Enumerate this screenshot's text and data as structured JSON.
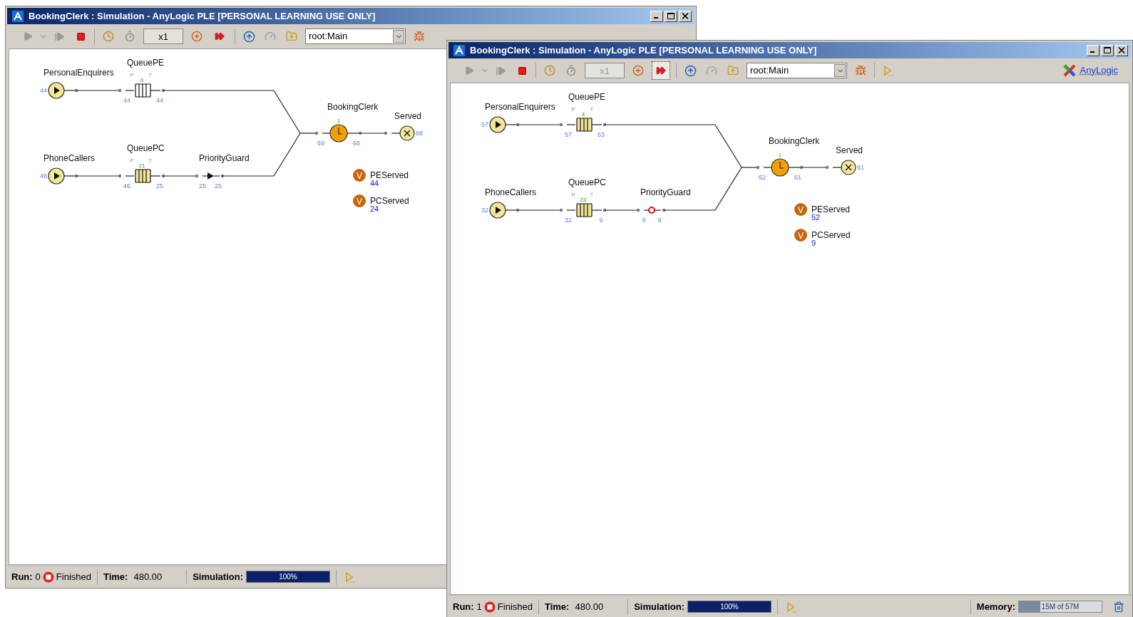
{
  "windows": [
    {
      "title": "BookingClerk : Simulation - AnyLogic PLE [PERSONAL LEARNING USE ONLY]",
      "toolbar": {
        "speed": {
          "value": "x1",
          "disabled": false
        },
        "model": "root:Main",
        "fast_forward_pressed": false
      },
      "diagram": {
        "sources": [
          {
            "name": "PersonalEnquirers",
            "count": "44"
          },
          {
            "name": "PhoneCallers",
            "count": "46"
          }
        ],
        "queues": [
          {
            "name": "QueuePE",
            "p": "P",
            "t": "T",
            "size": "0",
            "in": "44",
            "out": "44",
            "filled": false
          },
          {
            "name": "QueuePC",
            "p": "P",
            "t": "T",
            "size": "21",
            "in": "46",
            "out": "25",
            "filled": true
          }
        ],
        "hold": {
          "name": "PriorityGuard",
          "in": "25",
          "out": "25",
          "blocked": false
        },
        "service": {
          "name": "BookingClerk",
          "busy": "1",
          "in": "69",
          "out": "68"
        },
        "sink": {
          "name": "Served",
          "count": "68"
        },
        "variables": [
          {
            "icon": "V",
            "name": "PEServed",
            "value": "44"
          },
          {
            "icon": "V",
            "name": "PCServed",
            "value": "24"
          }
        ]
      },
      "status_bar": {
        "run_label": "Run:",
        "run": "0",
        "state": "Finished",
        "time_label": "Time:",
        "time": "480.00",
        "simulation_label": "Simulation:",
        "progress": {
          "level": 1,
          "text": "100%"
        }
      }
    },
    {
      "title": "BookingClerk : Simulation - AnyLogic PLE [PERSONAL LEARNING USE ONLY]",
      "toolbar": {
        "speed": {
          "value": "x1",
          "disabled": true
        },
        "model": "root:Main",
        "fast_forward_pressed": true,
        "link": "AnyLogic"
      },
      "diagram": {
        "sources": [
          {
            "name": "PersonalEnquirers",
            "count": "57"
          },
          {
            "name": "PhoneCallers",
            "count": "32"
          }
        ],
        "queues": [
          {
            "name": "QueuePE",
            "p": "P",
            "t": "T",
            "size": "4",
            "in": "57",
            "out": "53",
            "filled": true
          },
          {
            "name": "QueuePC",
            "p": "P",
            "t": "T",
            "size": "23",
            "in": "32",
            "out": "9",
            "filled": true
          }
        ],
        "hold": {
          "name": "PriorityGuard",
          "in": "9",
          "out": "9",
          "blocked": true
        },
        "service": {
          "name": "BookingClerk",
          "busy": "1",
          "in": "62",
          "out": "61"
        },
        "sink": {
          "name": "Served",
          "count": "61"
        },
        "variables": [
          {
            "icon": "V",
            "name": "PEServed",
            "value": "52"
          },
          {
            "icon": "V",
            "name": "PCServed",
            "value": "9"
          }
        ]
      },
      "status_bar": {
        "run_label": "Run:",
        "run": "1",
        "state": "Finished",
        "time_label": "Time:",
        "time": "480.00",
        "simulation_label": "Simulation:",
        "progress": {
          "level": 1,
          "text": "100%"
        },
        "memory": {
          "label": "Memory:",
          "text": "15M of 57M",
          "level": 0.26
        }
      }
    }
  ]
}
